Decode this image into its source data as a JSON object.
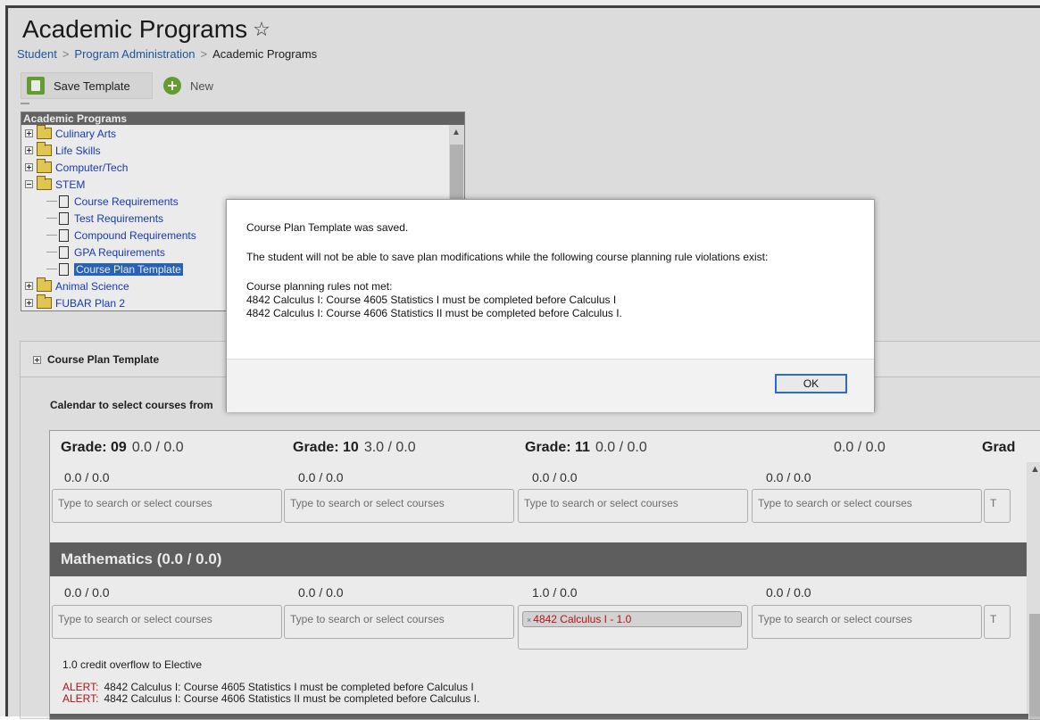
{
  "page": {
    "title": "Academic Programs",
    "star_icon": "star-outline-icon"
  },
  "breadcrumb": {
    "items": [
      "Student",
      "Program Administration",
      "Academic Programs"
    ],
    "separator": ">"
  },
  "toolbar": {
    "save_label": "Save Template",
    "new_label": "New"
  },
  "tree": {
    "header": "Academic Programs",
    "programs": {
      "culinary": "Culinary Arts",
      "life_skills": "Life Skills",
      "computer": "Computer/Tech",
      "stem": "STEM",
      "animal": "Animal Science",
      "fubar": "FUBAR Plan 2"
    },
    "stem_children": [
      "Course Requirements",
      "Test Requirements",
      "Compound Requirements",
      "GPA Requirements",
      "Course Plan Template"
    ],
    "selected": "Course Plan Template"
  },
  "panel": {
    "title": "Course Plan Template",
    "calendar_label": "Calendar to select courses from"
  },
  "grades": [
    {
      "label": "Grade: 09",
      "credits": "0.0 / 0.0"
    },
    {
      "label": "Grade: 10",
      "credits": "3.0 / 0.0"
    },
    {
      "label": "Grade: 11",
      "credits": "0.0 / 0.0"
    },
    {
      "label": "",
      "credits": "0.0 / 0.0"
    },
    {
      "label": "Grad",
      "credits": ""
    }
  ],
  "top_row": {
    "credits": [
      "0.0 / 0.0",
      "0.0 / 0.0",
      "0.0 / 0.0",
      "0.0 / 0.0"
    ],
    "placeholder": "Type to search or select courses",
    "cut_placeholder": "T"
  },
  "mathematics": {
    "title": "Mathematics (0.0 / 0.0)",
    "credits": [
      "0.0 / 0.0",
      "0.0 / 0.0",
      "1.0 / 0.0",
      "0.0 / 0.0"
    ],
    "selected_course": "4842 Calculus I - 1.0",
    "remove_symbol": "×",
    "overflow_text": "1.0 credit overflow to Elective"
  },
  "alerts": {
    "tag": "ALERT:",
    "messages": [
      "4842 Calculus I: Course 4605 Statistics I must be completed before Calculus I",
      "4842 Calculus I: Course 4606 Statistics II must be completed before Calculus I."
    ]
  },
  "modal": {
    "line1": "Course Plan Template was saved.",
    "line2": "The student will not be able to save plan modifications while the following course planning rule violations exist:",
    "line3": "Course planning rules not met:",
    "line4": "4842 Calculus I: Course 4605 Statistics I must be completed before Calculus I",
    "line5": "4842 Calculus I: Course 4606 Statistics II must be completed before Calculus I.",
    "ok_label": "OK"
  },
  "colors": {
    "accent_green": "#6eaa37",
    "link_blue": "#1f5fa8",
    "tree_blue": "#1a3fbf",
    "selection_blue": "#2a6cc8",
    "alert_red": "#c0161c",
    "section_gray": "#666666"
  }
}
